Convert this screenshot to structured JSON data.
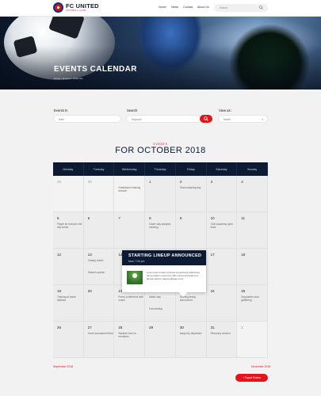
{
  "header": {
    "brand": "FC UNITED",
    "brand_sub": "FOOTBALL CLUB",
    "nav": [
      "Home",
      "News",
      "Contact",
      "About Us"
    ],
    "search_placeholder": "Search"
  },
  "hero": {
    "title": "EVENTS CALENDAR",
    "breadcrumb": "Home / Events / Calendar"
  },
  "filters": {
    "events_in_label": "Events In",
    "events_in_value": "Date",
    "search_label": "Search",
    "search_value": "Keyword",
    "view_as_label": "View as:",
    "view_as_value": "Month"
  },
  "month": {
    "eyebrow": "EVENTS",
    "title": "FOR OCTOBER 2018"
  },
  "calendar": {
    "days": [
      "Monday",
      "Tuesday",
      "Wednesday",
      "Thursday",
      "Friday",
      "Saturday",
      "Sunday"
    ],
    "weeks": [
      [
        {
          "num": "29",
          "other": true
        },
        {
          "num": "30",
          "other": true
        },
        {
          "num": "",
          "other": true,
          "ev": "Goalkeeper training session"
        },
        {
          "num": "1"
        },
        {
          "num": "2",
          "ev": "Team cleaning day"
        },
        {
          "num": "3"
        },
        {
          "num": "4"
        }
      ],
      [
        {
          "num": "5",
          "ev": "Player kit reveal in the city center"
        },
        {
          "num": "6"
        },
        {
          "num": "7"
        },
        {
          "num": "8",
          "ev": "Game day analysis meeting"
        },
        {
          "num": "9"
        },
        {
          "num": "10",
          "ev": "Club academy open trials"
        },
        {
          "num": "11"
        }
      ],
      [
        {
          "num": "12"
        },
        {
          "num": "13",
          "ev": "Charity match",
          "ev2": "Season opener"
        },
        {
          "num": "14"
        },
        {
          "num": "15"
        },
        {
          "num": "16"
        },
        {
          "num": "17"
        },
        {
          "num": "18"
        }
      ],
      [
        {
          "num": "19",
          "ev": "Training at home stadium"
        },
        {
          "num": "20"
        },
        {
          "num": "21",
          "ev": "Press conference with coach"
        },
        {
          "num": "22",
          "ev": "Match day",
          "ev2": "Fan meetup"
        },
        {
          "num": "23",
          "ev": "Starting lineup announced"
        },
        {
          "num": "24"
        },
        {
          "num": "25",
          "ev": "Supporters club gathering"
        }
      ],
      [
        {
          "num": "26"
        },
        {
          "num": "27",
          "ev": "Youth tournament final"
        },
        {
          "num": "28",
          "ev": "Stadium tour for members"
        },
        {
          "num": "29"
        },
        {
          "num": "30",
          "ev": "Away trip departure"
        },
        {
          "num": "31",
          "ev": "Recovery session"
        },
        {
          "num": "1",
          "other": true
        }
      ]
    ]
  },
  "tooltip": {
    "title": "STARTING LINEUP ANNOUNCED",
    "time": "Now: 7:00 pm",
    "desc": "Lorem ipsum dolor sit amet consectetur adipiscing elit sed diam nonummy nibh euismod tincidunt ut laoreet dolore magna aliquam erat."
  },
  "footer": {
    "prev": "September 2018",
    "next": "November 2018",
    "export": "+ Export Events"
  },
  "colors": {
    "accent": "#e3141c",
    "navy": "#0d1a33"
  }
}
